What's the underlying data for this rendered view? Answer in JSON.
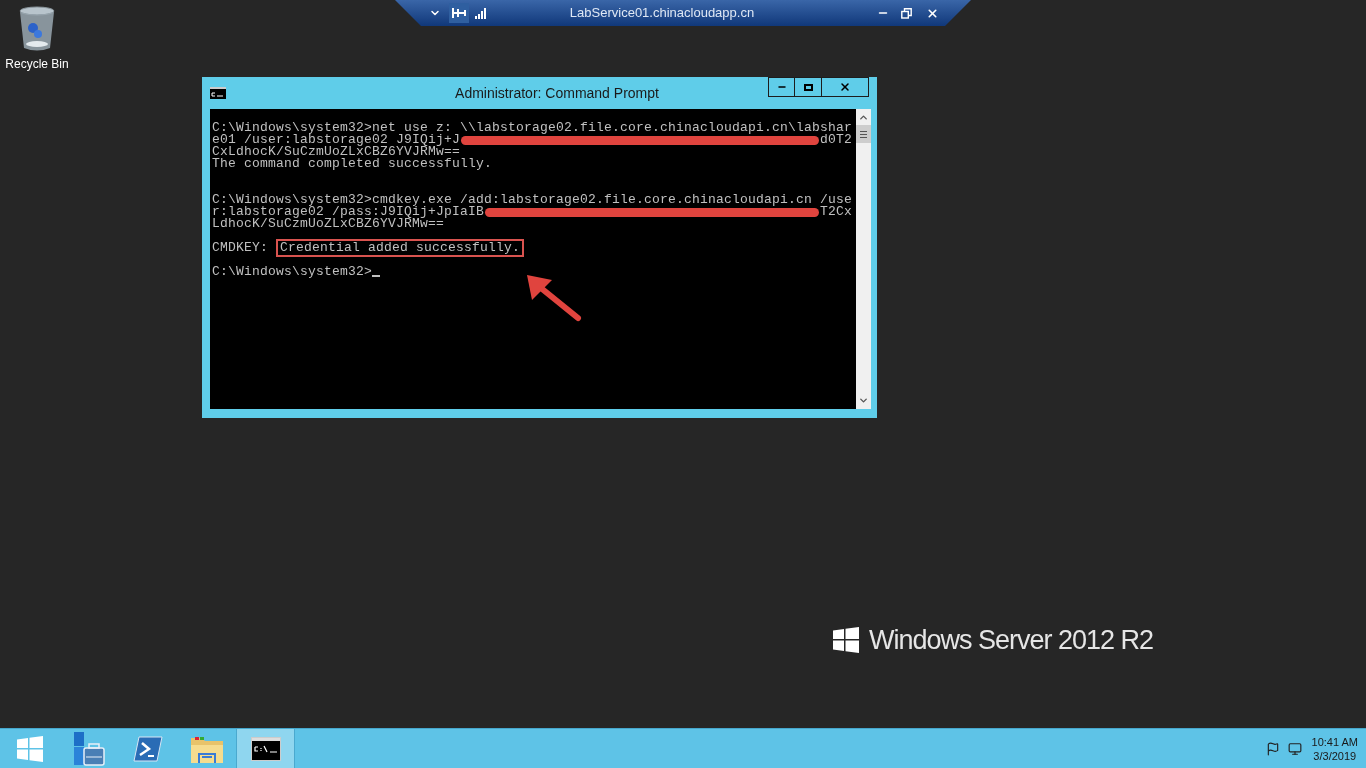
{
  "desktop_icons": [
    {
      "label": "Recycle Bin"
    }
  ],
  "remote_bar": {
    "title": "LabService01.chinacloudapp.cn",
    "pinned": true
  },
  "window": {
    "title": "Administrator: Command Prompt",
    "lines": [
      {
        "kind": "text",
        "segments": [
          {
            "kind": "text",
            "text": "C:\\Windows\\system32>net use z: \\\\labstorage02.file.core.chinacloudapi.cn\\labshar"
          }
        ]
      },
      {
        "kind": "text",
        "segments": [
          {
            "kind": "text",
            "text": "e01 /user:labstorage02 J9IQij+J"
          },
          {
            "kind": "redaction"
          },
          {
            "kind": "text",
            "text": "d0T2"
          }
        ]
      },
      {
        "kind": "text",
        "segments": [
          {
            "kind": "text",
            "text": "CxLdhocK/SuCzmUoZLxCBZ6YVJRMw=="
          }
        ]
      },
      {
        "kind": "text",
        "segments": [
          {
            "kind": "text",
            "text": "The command completed successfully."
          }
        ]
      },
      {
        "kind": "blank"
      },
      {
        "kind": "blank"
      },
      {
        "kind": "text",
        "segments": [
          {
            "kind": "text",
            "text": "C:\\Windows\\system32>cmdkey.exe /add:labstorage02.file.core.chinacloudapi.cn /use"
          }
        ]
      },
      {
        "kind": "text",
        "segments": [
          {
            "kind": "text",
            "text": "r:labstorage02 /pass:J9IQij+JpIaIB"
          },
          {
            "kind": "redaction"
          },
          {
            "kind": "text",
            "text": "T2Cx"
          }
        ]
      },
      {
        "kind": "text",
        "segments": [
          {
            "kind": "text",
            "text": "LdhocK/SuCzmUoZLxCBZ6YVJRMw=="
          }
        ]
      },
      {
        "kind": "blank"
      },
      {
        "kind": "text",
        "segments": [
          {
            "kind": "text",
            "text": "CMDKEY: "
          },
          {
            "kind": "boxed",
            "text": "Credential added successfully."
          }
        ]
      },
      {
        "kind": "blank"
      },
      {
        "kind": "text",
        "segments": [
          {
            "kind": "text",
            "text": "C:\\Windows\\system32>"
          },
          {
            "kind": "cursor"
          }
        ]
      }
    ]
  },
  "branding": {
    "text": "Windows Server 2012 R2"
  },
  "taskbar": {
    "items": [
      {
        "kind": "start",
        "selected": false
      },
      {
        "kind": "server-manager",
        "selected": false
      },
      {
        "kind": "powershell",
        "selected": false
      },
      {
        "kind": "explorer",
        "selected": false
      },
      {
        "kind": "cmd",
        "selected": true
      }
    ],
    "clock": {
      "time": "10:41 AM",
      "date": "3/3/2019"
    }
  }
}
